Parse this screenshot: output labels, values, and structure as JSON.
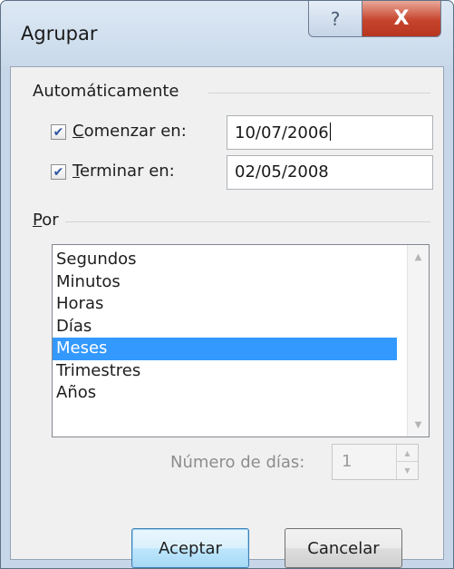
{
  "window": {
    "title": "Agrupar",
    "help_glyph": "?",
    "close_glyph": "X"
  },
  "auto_group": {
    "label": "Automáticamente",
    "start": {
      "checked": true,
      "label_underline": "C",
      "label_rest": "omenzar en:",
      "value": "10/07/2006"
    },
    "end": {
      "checked": true,
      "label_underline": "T",
      "label_rest": "erminar en:",
      "value": "02/05/2008"
    }
  },
  "by_group": {
    "label_underline": "P",
    "label_rest": "or",
    "items": [
      "Segundos",
      "Minutos",
      "Horas",
      "Días",
      "Meses",
      "Trimestres",
      "Años"
    ],
    "selected_index": 4
  },
  "days": {
    "label": "Número de días:",
    "value": "1",
    "enabled": false
  },
  "buttons": {
    "ok_label": "Aceptar",
    "cancel_label": "Cancelar"
  },
  "colors": {
    "selection": "#3399ff",
    "checkmark": "#2e56a0",
    "close_button": "#c6442c"
  }
}
